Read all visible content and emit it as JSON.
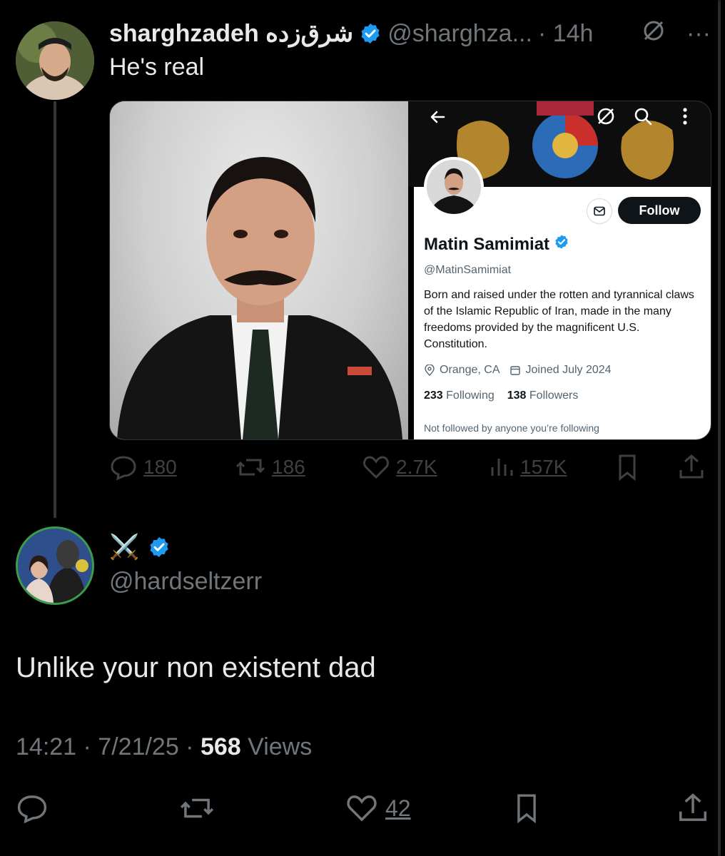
{
  "tweet1": {
    "display_name": "sharghzadeh شرق‌زده",
    "handle": "@sharghza...",
    "time": "· 14h",
    "more": "···",
    "text": "He's real",
    "embedded_profile": {
      "name": "Matin Samimiat",
      "handle": "@MatinSamimiat",
      "follow_label": "Follow",
      "bio": "Born and raised under the rotten and tyrannical claws of the Islamic Republic of Iran, made in the many freedoms provided by the magnificent U.S. Constitution.",
      "location": "Orange, CA",
      "joined": "Joined July 2024",
      "following_count": "233",
      "following_label": "Following",
      "followers_count": "138",
      "followers_label": "Followers",
      "not_followed": "Not followed by anyone you’re following"
    },
    "actions": {
      "replies": "180",
      "reposts": "186",
      "likes": "2.7K",
      "views": "157K"
    }
  },
  "tweet2": {
    "display_name": "⚔️",
    "handle": "@hardseltzerr",
    "text": "Unlike your non existent dad",
    "time": "14:21 · 7/21/25 · ",
    "views_count": "568",
    "views_label": " Views",
    "actions": {
      "likes": "42"
    }
  },
  "colors": {
    "background": "#000000",
    "text": "#e7e9ea",
    "muted": "#71767b",
    "verified": "#1d9bf0"
  }
}
